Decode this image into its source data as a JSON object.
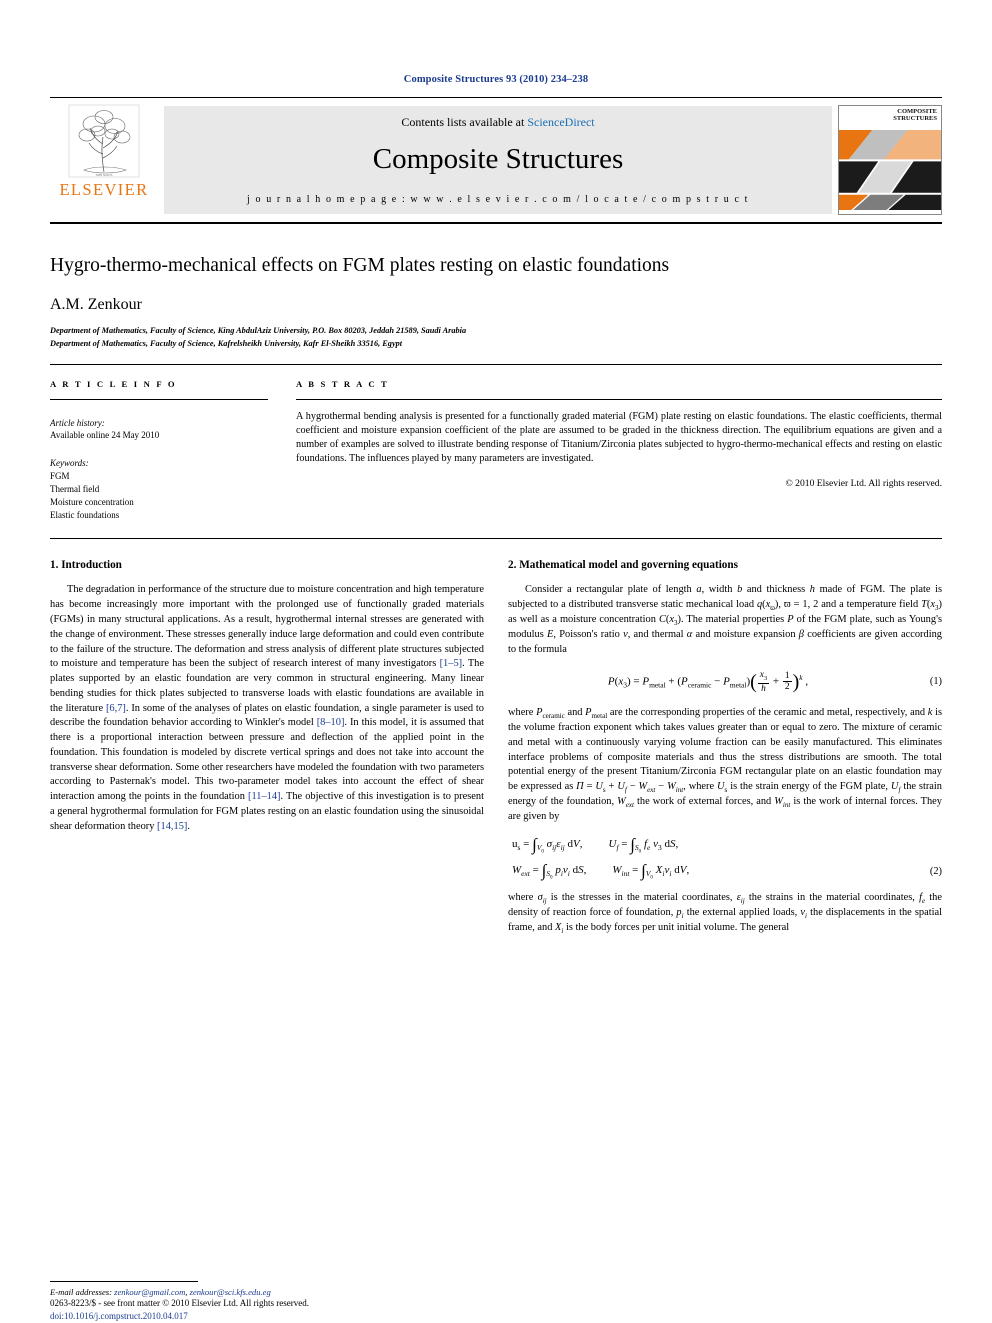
{
  "journal": {
    "reference": "Composite Structures 93 (2010) 234–238",
    "contents_prefix": "Contents lists available at ",
    "contents_link": "ScienceDirect",
    "title": "Composite Structures",
    "homepage": "j o u r n a l   h o m e p a g e :   w w w . e l s e v i e r . c o m / l o c a t e / c o m p s t r u c t",
    "publisher": "ELSEVIER",
    "cover_line1": "COMPOSITE",
    "cover_line2": "STRUCTURES",
    "accent_orange": "#E87511",
    "link_blue": "#1a3b8f"
  },
  "article": {
    "title": "Hygro-thermo-mechanical effects on FGM plates resting on elastic foundations",
    "author": "A.M. Zenkour",
    "affiliations": [
      "Department of Mathematics, Faculty of Science, King AbdulAziz University, P.O. Box 80203, Jeddah 21589, Saudi Arabia",
      "Department of Mathematics, Faculty of Science, Kafrelsheikh University, Kafr El-Sheikh 33516, Egypt"
    ]
  },
  "info": {
    "heading": "A R T I C L E   I N F O",
    "history_label": "Article history:",
    "history_line": "Available online 24 May 2010",
    "keywords_label": "Keywords:",
    "keywords": [
      "FGM",
      "Thermal field",
      "Moisture concentration",
      "Elastic foundations"
    ]
  },
  "abstract": {
    "heading": "A B S T R A C T",
    "text": "A hygrothermal bending analysis is presented for a functionally graded material (FGM) plate resting on elastic foundations. The elastic coefficients, thermal coefficient and moisture expansion coefficient of the plate are assumed to be graded in the thickness direction. The equilibrium equations are given and a number of examples are solved to illustrate bending response of Titanium/Zirconia plates subjected to hygro-thermo-mechanical effects and resting on elastic foundations. The influences played by many parameters are investigated.",
    "copyright": "© 2010 Elsevier Ltd. All rights reserved."
  },
  "sections": {
    "intro_heading": "1. Introduction",
    "intro_p1_a": "The degradation in performance of the structure due to moisture concentration and high temperature has become increasingly more important with the prolonged use of functionally graded materials (FGMs) in many structural applications. As a result, hygrothermal internal stresses are generated with the change of environment. These stresses generally induce large deformation and could even contribute to the failure of the structure. The deformation and stress analysis of different plate structures subjected to moisture and temperature has been the subject of research interest of many investigators ",
    "intro_ref1": "[1–5]",
    "intro_p1_b": ". The plates supported by an elastic foundation are very common in structural engineering. Many linear bending studies for thick plates subjected to transverse loads with elastic foundations are available in the literature ",
    "intro_ref2": "[6,7]",
    "intro_p1_c": ". In some of the analyses of plates on elastic foundation, a single parameter is used to describe the foundation behavior according to Winkler's model ",
    "intro_ref3": "[8–10]",
    "intro_p1_d": ". In this model, it is assumed that there is a proportional interaction between pressure and deflection of the applied point in the foundation. This foundation is modeled by discrete vertical springs and does not take into account the transverse shear deformation. Some other researchers have modeled the foundation with two parameters according to Pasternak's model. This two-parameter model takes into account the effect of shear interaction among the points in the foundation ",
    "intro_ref4": "[11–14]",
    "intro_p1_e": ". The objective of this investigation is to present a general hygrothermal formulation for FGM plates resting on an elastic foundation using the sinusoidal shear deformation theory ",
    "intro_ref5": "[14,15]",
    "intro_p1_f": ".",
    "model_heading": "2. Mathematical model and governing equations",
    "model_p1": "Consider a rectangular plate of length a, width b and thickness h made of FGM. The plate is subjected to a distributed transverse static mechanical load q(x₃), ϖ = 1, 2 and a temperature field T(x₃) as well as a moisture concentration C(x₃). The material properties P of the FGM plate, such as Young's modulus E, Poisson's ratio ν, and thermal α and moisture expansion β coefficients are given according to the formula",
    "eq1_num": "(1)",
    "model_p2": "where P_ceramic and P_metal are the corresponding properties of the ceramic and metal, respectively, and k is the volume fraction exponent which takes values greater than or equal to zero. The mixture of ceramic and metal with a continuously varying volume fraction can be easily manufactured. This eliminates interface problems of composite materials and thus the stress distributions are smooth. The total potential energy of the present Titanium/Zirconia FGM rectangular plate on an elastic foundation may be expressed as Π = U_s + U_f − W_ext − W_int, where U_s is the strain energy of the FGM plate, U_f the strain energy of the foundation, W_ext the work of external forces, and W_int is the work of internal forces. They are given by",
    "eq2_num": "(2)",
    "model_p3": "where σ_ij is the stresses in the material coordinates, ε_ij the strains in the material coordinates, f_e the density of reaction force of foundation, p_i the external applied loads, v_i the displacements in the spatial frame, and X_i is the body forces per unit initial volume. The general"
  },
  "footer": {
    "email_label": "E-mail addresses:",
    "email1": "zenkour@gmail.com",
    "email2": "zenkour@sci.kfs.edu.eg",
    "issn_line": "0263-8223/$ - see front matter © 2010 Elsevier Ltd. All rights reserved.",
    "doi_label": "doi:",
    "doi": "10.1016/j.compstruct.2010.04.017"
  }
}
